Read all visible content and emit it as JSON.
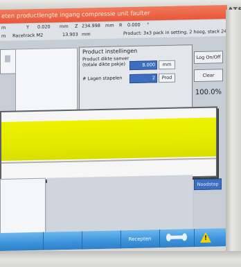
{
  "brand": "SIGMATE",
  "alarm": {
    "text": "eten productlengte ingang compressie unit faulter"
  },
  "status": {
    "row1": {
      "a": "m",
      "b": "Y",
      "c": "0.020",
      "d": "mm",
      "e": "Z",
      "f": "234.998",
      "g": "mm",
      "h": "R",
      "i": "0.000",
      "j": "°"
    },
    "row2": {
      "a": "m",
      "b": "Racetrack M2",
      "c": "13.903",
      "d": "mm",
      "e": "Product: 3x3 pack in setting, 2 hoog, stack 24"
    }
  },
  "settings": {
    "title": "Product instellingen",
    "thickness_label_1": "Product dikte sanver",
    "thickness_label_2": "(totale dikte pakje)",
    "thickness_value": "8.000",
    "thickness_unit": "mm",
    "layers_label": "# Lagen stapelen",
    "layers_value": "2",
    "layers_unit": "Prod"
  },
  "right_panel": {
    "log_button": "Log On/Off",
    "clear_button": "Clear",
    "percent": "100.0%",
    "nootstop_button": "Noodstop"
  },
  "bottom_bar": {
    "recepten_label": "Recepten"
  },
  "icons": {
    "wrench": "wrench-icon",
    "warning": "warning-icon"
  },
  "colors": {
    "alarm": "#e9573a",
    "dialog_band": "#e4ea00",
    "accent_blue": "#3d6fc1",
    "bottom_bar": "#3d95dd",
    "warning": "#f4d300"
  }
}
